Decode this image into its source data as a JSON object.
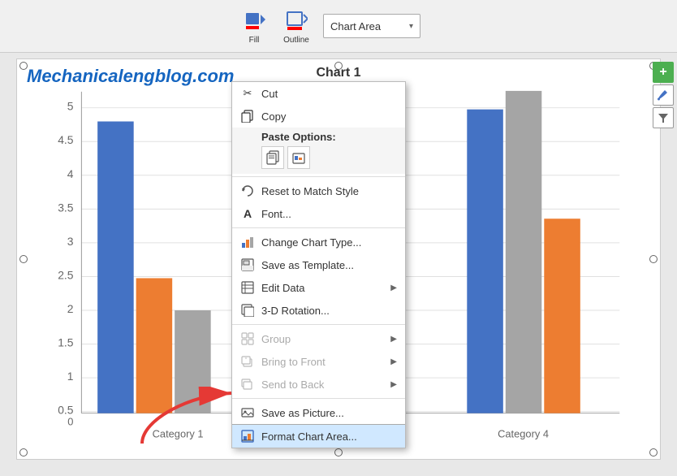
{
  "ribbon": {
    "fill_label": "Fill",
    "outline_label": "Outline",
    "dropdown": {
      "text": "Chart Area",
      "arrow": "▾"
    }
  },
  "watermark": "Mechanicalengblog.com",
  "chart": {
    "title": "Chart 1",
    "y_axis": [
      "5",
      "4.5",
      "4",
      "3.5",
      "3",
      "2.5",
      "2",
      "1.5",
      "1",
      "0.5",
      "0"
    ],
    "categories": [
      "Category 1",
      "Category 4"
    ]
  },
  "side_panel": {
    "add_btn": "+",
    "brush_btn": "🖌",
    "filter_btn": "▼"
  },
  "context_menu": {
    "items": [
      {
        "id": "cut",
        "icon": "✂",
        "label": "Cut",
        "disabled": false,
        "has_arrow": false
      },
      {
        "id": "copy",
        "icon": "📋",
        "label": "Copy",
        "disabled": false,
        "has_arrow": false
      },
      {
        "id": "paste-options",
        "label": "Paste Options:",
        "type": "paste-header"
      },
      {
        "id": "reset-style",
        "icon": "↺",
        "label": "Reset to Match Style",
        "disabled": false,
        "has_arrow": false
      },
      {
        "id": "font",
        "icon": "A",
        "label": "Font...",
        "disabled": false,
        "has_arrow": false
      },
      {
        "id": "change-chart-type",
        "icon": "📊",
        "label": "Change Chart Type...",
        "disabled": false,
        "has_arrow": false
      },
      {
        "id": "save-as-template",
        "icon": "💾",
        "label": "Save as Template...",
        "disabled": false,
        "has_arrow": false
      },
      {
        "id": "edit-data",
        "icon": "⊞",
        "label": "Edit Data",
        "disabled": false,
        "has_arrow": true
      },
      {
        "id": "3d-rotation",
        "icon": "⬚",
        "label": "3-D Rotation...",
        "disabled": false,
        "has_arrow": false
      },
      {
        "id": "group",
        "icon": "⊞",
        "label": "Group",
        "disabled": true,
        "has_arrow": true
      },
      {
        "id": "bring-to-front",
        "icon": "⊞",
        "label": "Bring to Front",
        "disabled": true,
        "has_arrow": true
      },
      {
        "id": "send-to-back",
        "icon": "⊞",
        "label": "Send to Back",
        "disabled": true,
        "has_arrow": true
      },
      {
        "id": "save-as-picture",
        "icon": "🖼",
        "label": "Save as Picture...",
        "disabled": false,
        "has_arrow": false
      },
      {
        "id": "format-chart-area",
        "icon": "📐",
        "label": "Format Chart Area...",
        "disabled": false,
        "has_arrow": false,
        "highlighted": true
      }
    ]
  }
}
